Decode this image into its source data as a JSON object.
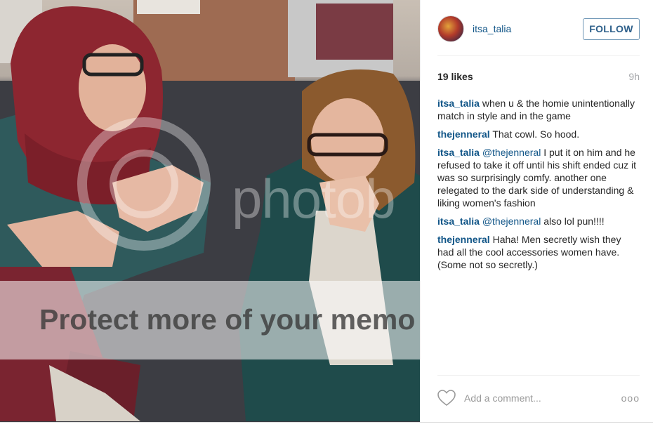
{
  "photo": {
    "watermark_logo": "photob",
    "watermark_text": "Protect more of your memo"
  },
  "post": {
    "username": "itsa_talia",
    "follow_label": "FOLLOW",
    "likes": "19 likes",
    "time": "9h"
  },
  "comments": [
    {
      "user": "itsa_talia",
      "mention": "",
      "text": "when u & the homie unintentionally match in style and in the game"
    },
    {
      "user": "thejenneral",
      "mention": "",
      "text": "That cowl. So hood."
    },
    {
      "user": "itsa_talia",
      "mention": "@thejenneral",
      "text": "I put it on him and he refused to take it off until his shift ended cuz it was so surprisingly comfy. another one relegated to the dark side of understanding & liking women's fashion"
    },
    {
      "user": "itsa_talia",
      "mention": "@thejenneral",
      "text": "also lol pun!!!!"
    },
    {
      "user": "thejenneral",
      "mention": "",
      "text": "Haha! Men secretly wish they had all the cool accessories women have. (Some not so secretly.)"
    }
  ],
  "footer": {
    "add_comment_placeholder": "Add a comment...",
    "more_label": "ooo"
  },
  "icons": {
    "heart": "heart-icon",
    "more": "more-options-icon"
  },
  "colors": {
    "link": "#125688",
    "follow_border": "#6f97b6"
  }
}
